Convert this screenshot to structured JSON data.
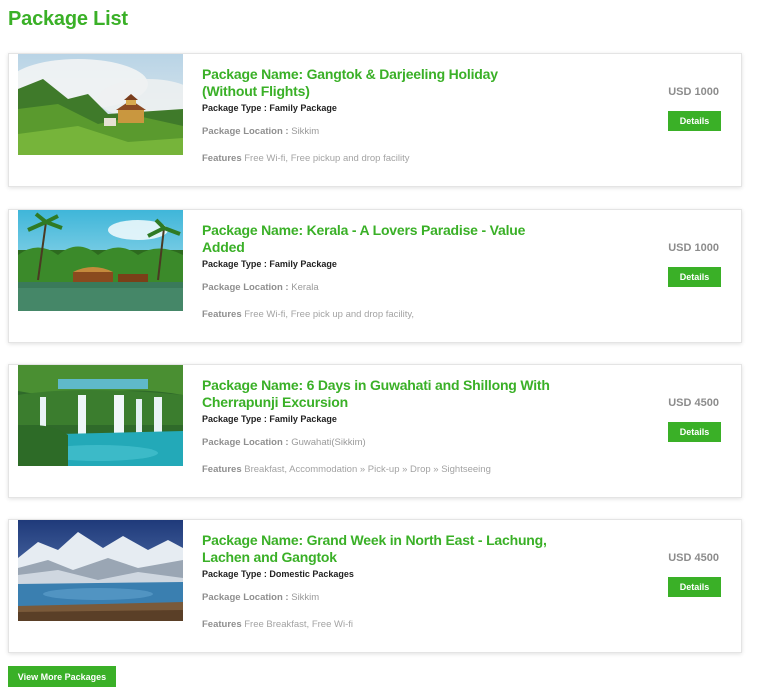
{
  "page": {
    "title": "Package List"
  },
  "labels": {
    "type_prefix": "Package Type :",
    "location_prefix": "Package Location :",
    "features_prefix": "Features",
    "details_button": "Details",
    "view_more_button": "View More Packages"
  },
  "packages": [
    {
      "name": "Package Name: Gangtok & Darjeeling Holiday (Without Flights)",
      "type": "Family Package",
      "location": "Sikkim",
      "features": "Free Wi-fi, Free pickup and drop facility",
      "price": "USD 1000",
      "image": "misty-mountain-monastery"
    },
    {
      "name": "Package Name: Kerala - A Lovers Paradise - Value Added",
      "type": "Family Package",
      "location": "Kerala",
      "features": "Free Wi-fi, Free pick up and drop facility,",
      "price": "USD 1000",
      "image": "kerala-backwater-houseboat"
    },
    {
      "name": "Package Name: 6 Days in Guwahati and Shillong With Cherrapunji Excursion",
      "type": "Family Package",
      "location": "Guwahati(Sikkim)",
      "features": "Breakfast, Accommodation » Pick-up » Drop » Sightseeing",
      "price": "USD 4500",
      "image": "waterfalls-lake"
    },
    {
      "name": "Package Name: Grand Week in North East - Lachung, Lachen and Gangtok",
      "type": "Domestic Packages",
      "location": "Sikkim",
      "features": "Free Breakfast, Free Wi-fi",
      "price": "USD 4500",
      "image": "snow-mountain-lake"
    }
  ]
}
